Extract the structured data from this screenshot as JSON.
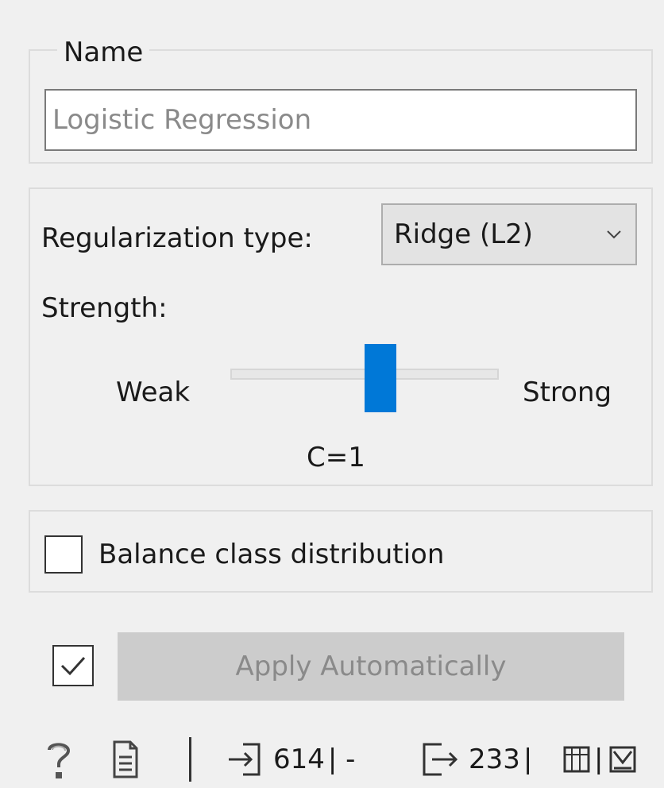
{
  "name_group": {
    "legend": "Name",
    "input_placeholder": "Logistic Regression",
    "input_value": ""
  },
  "regularization": {
    "type_label": "Regularization type:",
    "type_selected": "Ridge (L2)",
    "strength_label": "Strength:",
    "weak_label": "Weak",
    "strong_label": "Strong",
    "slider_level": 0.5,
    "c_value_label": "C=1"
  },
  "balance": {
    "label": "Balance class distribution",
    "checked": false
  },
  "apply": {
    "checkbox_checked": true,
    "button_label": "Apply Automatically"
  },
  "status_bar": {
    "input_count": "614",
    "input_sep": "| -",
    "output_count": "233",
    "output_sep": "|"
  },
  "colors": {
    "accent": "#0078d7",
    "background": "#f0f0f0",
    "disabled_text": "#8a8a8a"
  },
  "icons": [
    "help-icon",
    "report-icon",
    "input-data-icon",
    "output-data-icon",
    "data-view-icon",
    "warning-icon",
    "chevron-down-icon",
    "checkmark-icon"
  ]
}
